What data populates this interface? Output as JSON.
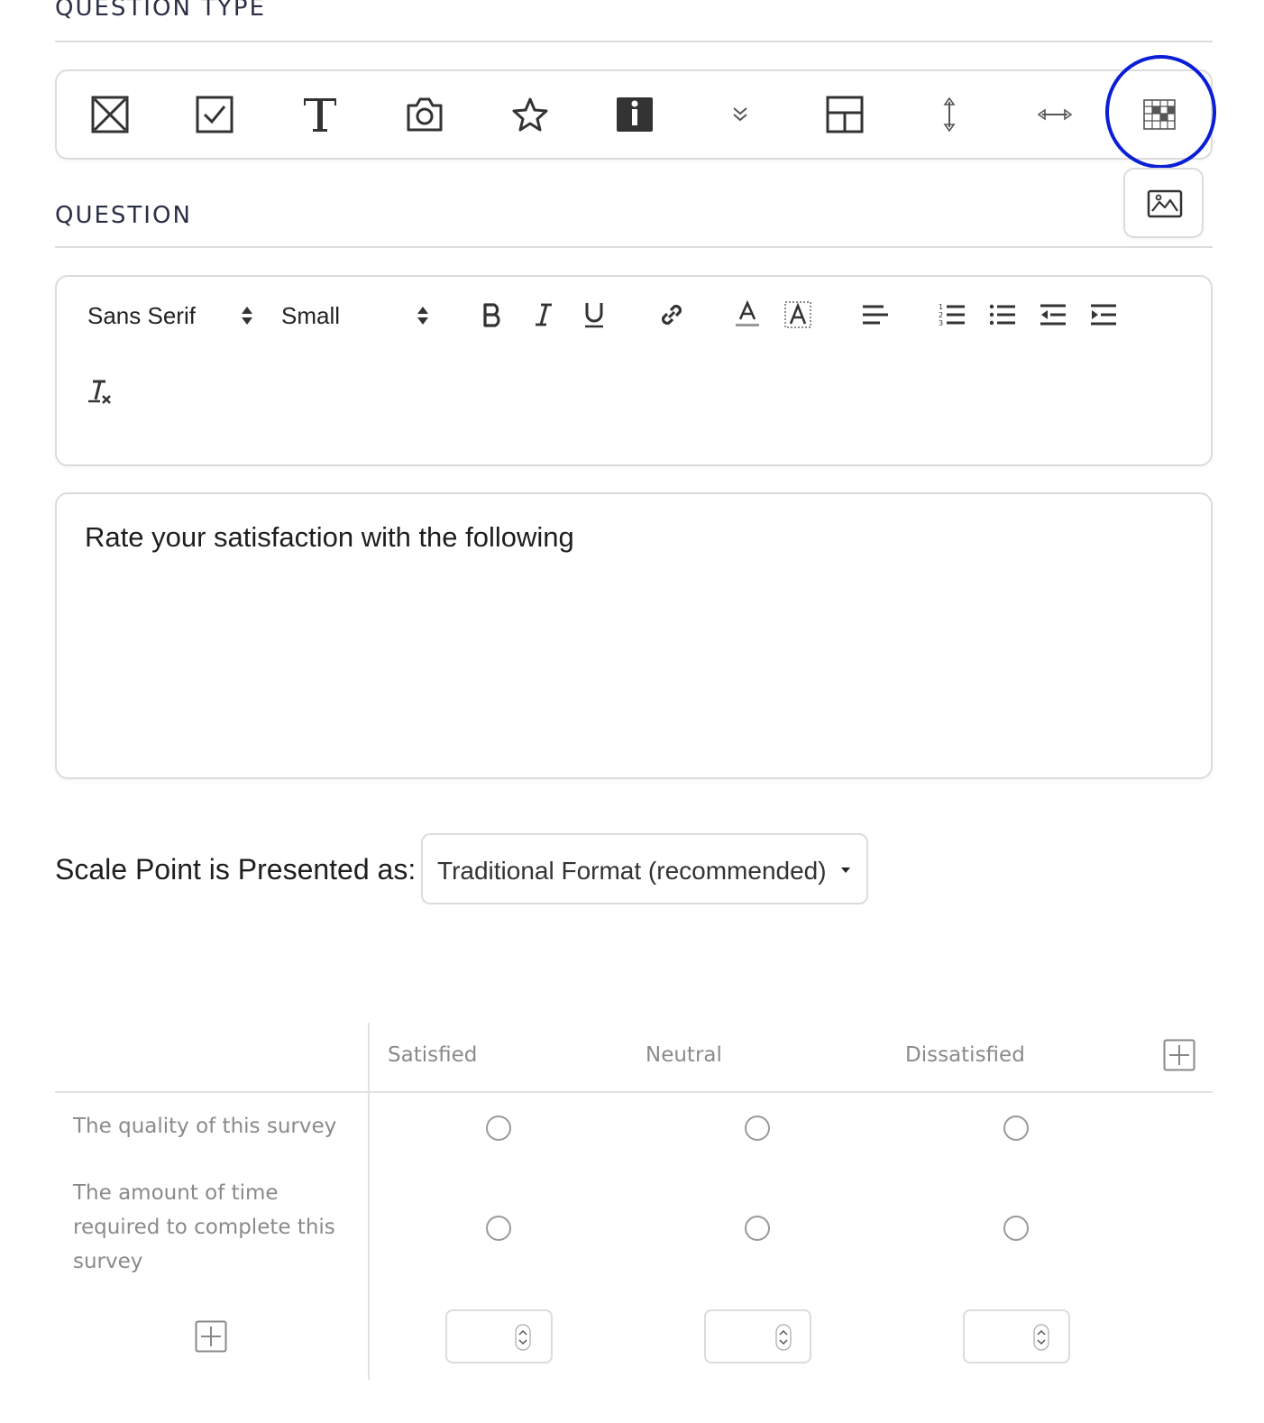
{
  "sections": {
    "question_type": "QUESTION TYPE",
    "question": "QUESTION"
  },
  "question_types": [
    {
      "name": "multiple-choice-icon"
    },
    {
      "name": "checkbox-icon"
    },
    {
      "name": "text-icon"
    },
    {
      "name": "photo-icon"
    },
    {
      "name": "star-rating-icon"
    },
    {
      "name": "info-icon"
    },
    {
      "name": "dropdown-icon"
    },
    {
      "name": "layout-icon"
    },
    {
      "name": "vertical-slider-icon"
    },
    {
      "name": "horizontal-slider-icon"
    },
    {
      "name": "matrix-icon",
      "selected": true
    }
  ],
  "toolbar": {
    "font_family": "Sans Serif",
    "font_size": "Small"
  },
  "editor": {
    "text": "Rate your satisfaction with the following"
  },
  "scale": {
    "label": "Scale Point is Presented as:",
    "selected": "Traditional Format (recommended)"
  },
  "matrix": {
    "columns": [
      "Satisfied",
      "Neutral",
      "Dissatisfied"
    ],
    "rows": [
      {
        "label": "The quality of this survey"
      },
      {
        "label": "The amount of time required to complete this survey"
      }
    ]
  },
  "colors": {
    "highlight_ring": "#0a1ed6",
    "border": "#dcdcdc",
    "muted_text": "#8a8a8a"
  }
}
